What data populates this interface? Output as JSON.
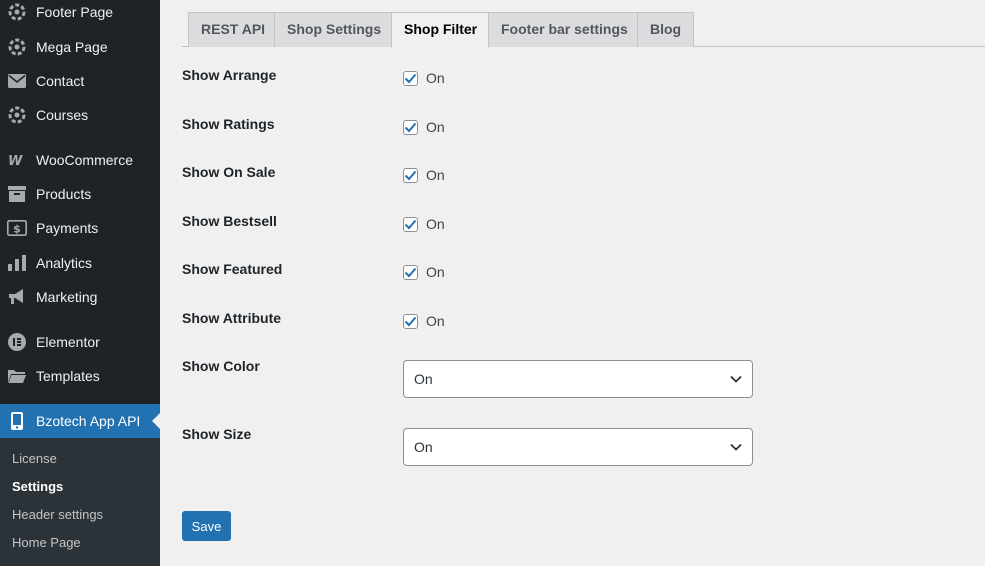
{
  "sidebar": {
    "items": [
      {
        "label": "Footer Page",
        "icon": "gear-cluster-icon"
      },
      {
        "label": "Mega Page",
        "icon": "gear-cluster-icon"
      },
      {
        "label": "Contact",
        "icon": "envelope-icon"
      },
      {
        "label": "Courses",
        "icon": "gear-cluster-icon"
      },
      {
        "label": "WooCommerce",
        "icon": "woocommerce-icon"
      },
      {
        "label": "Products",
        "icon": "archive-box-icon"
      },
      {
        "label": "Payments",
        "icon": "dollar-card-icon"
      },
      {
        "label": "Analytics",
        "icon": "bar-chart-icon"
      },
      {
        "label": "Marketing",
        "icon": "megaphone-icon"
      },
      {
        "label": "Elementor",
        "icon": "elementor-icon"
      },
      {
        "label": "Templates",
        "icon": "folder-icon"
      },
      {
        "label": "Bzotech App API",
        "icon": "mobile-phone-icon"
      }
    ],
    "submenu": [
      "License",
      "Settings",
      "Header settings",
      "Home Page"
    ],
    "submenu_current": "Settings"
  },
  "tabs": [
    {
      "label": "REST API"
    },
    {
      "label": "Shop Settings"
    },
    {
      "label": "Shop Filter"
    },
    {
      "label": "Footer bar settings"
    },
    {
      "label": "Blog"
    }
  ],
  "active_tab": "Shop Filter",
  "form": {
    "rows": [
      {
        "label": "Show Arrange",
        "type": "checkbox",
        "checked": true,
        "text": "On"
      },
      {
        "label": "Show Ratings",
        "type": "checkbox",
        "checked": true,
        "text": "On"
      },
      {
        "label": "Show On Sale",
        "type": "checkbox",
        "checked": true,
        "text": "On"
      },
      {
        "label": "Show Bestsell",
        "type": "checkbox",
        "checked": true,
        "text": "On"
      },
      {
        "label": "Show Featured",
        "type": "checkbox",
        "checked": true,
        "text": "On"
      },
      {
        "label": "Show Attribute",
        "type": "checkbox",
        "checked": true,
        "text": "On"
      },
      {
        "label": "Show Color",
        "type": "select",
        "value": "On"
      },
      {
        "label": "Show Size",
        "type": "select",
        "value": "On"
      }
    ],
    "save_label": "Save"
  },
  "colors": {
    "sidebar_bg": "#1d2327",
    "submenu_bg": "#2c3338",
    "accent": "#2271b1",
    "content_bg": "#f0f0f1"
  }
}
